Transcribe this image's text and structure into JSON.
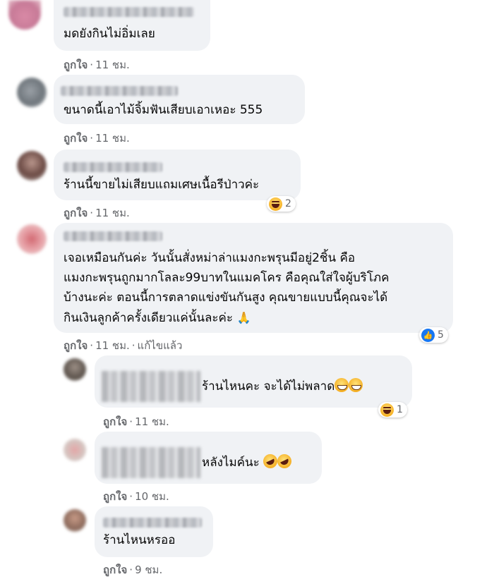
{
  "comments": [
    {
      "text": "มดยังกินไม่อิ่มเลย",
      "like": "ถูกใจ",
      "time": "11 ชม."
    },
    {
      "text": "ขนาดนี้เอาไม้จิ้มฟันเสียบเอาเหอะ 555",
      "like": "ถูกใจ",
      "time": "11 ชม."
    },
    {
      "text": "ร้านนี้ขายไม่เสียบแถมเศษเนื้อรีป่าวค่ะ",
      "like": "ถูกใจ",
      "time": "11 ชม.",
      "reaction": {
        "icon": "haha-icon",
        "count": "2"
      }
    },
    {
      "lines": [
        "เจอเหมือนกันค่ะ วันนั้นสั่งหม่าล่าแมงกะพรุนมีอยู่2ชิ้น คือ",
        "แมงกะพรุนถูกมากโลละ99บาทในแมคโคร คือคุณใส่ใจผู้บริโภค",
        "บ้างนะค่ะ ตอนนี้การตลาดแข่งขันกันสูง คุณขายแบบนี้คุณจะได้",
        "กินเงินลูกค้าครั้งเดียวแค่นั้นละค่ะ"
      ],
      "like": "ถูกใจ",
      "time": "11 ชม.",
      "edited": "แก้ไขแล้ว",
      "reaction": {
        "icon": "like-icon",
        "count": "5"
      }
    },
    {
      "text": "ร้านไหนคะ จะได้ไม่พลาด",
      "like": "ถูกใจ",
      "time": "11 ชม.",
      "reaction": {
        "icon": "haha-icon",
        "count": "1"
      }
    },
    {
      "text": "หลังไมค์นะ",
      "like": "ถูกใจ",
      "time": "10 ชม."
    },
    {
      "text": "ร้านไหนหรออ",
      "like": "ถูกใจ",
      "time": "9 ชม."
    }
  ],
  "dot": "·"
}
